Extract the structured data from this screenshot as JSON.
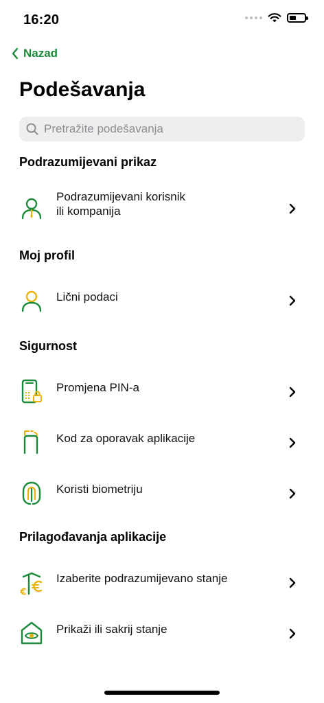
{
  "status": {
    "time": "16:20",
    "battery_level": 0.45
  },
  "nav": {
    "back_label": "Nazad"
  },
  "page": {
    "title": "Podešavanja"
  },
  "search": {
    "placeholder": "Pretražite podešavanja"
  },
  "sections": [
    {
      "title": "Podrazumijevani prikaz",
      "items": [
        {
          "label_line1": "Podrazumijevani korisnik",
          "label_line2": "ili kompanija",
          "icon": "user-default-icon"
        }
      ]
    },
    {
      "title": "Moj profil",
      "items": [
        {
          "label": "Lični podaci",
          "icon": "user-icon"
        }
      ]
    },
    {
      "title": "Sigurnost",
      "items": [
        {
          "label": "Promjena PIN-a",
          "icon": "phone-lock-icon"
        },
        {
          "label": "Kod za oporavak aplikacije",
          "icon": "app-recovery-icon"
        },
        {
          "label": "Koristi biometriju",
          "icon": "fingerprint-icon"
        }
      ]
    },
    {
      "title": "Prilagođavanja aplikacije",
      "items": [
        {
          "label": "Izaberite podrazumijevano stanje",
          "icon": "euro-balance-icon"
        },
        {
          "label": "Prikaži ili sakrij stanje",
          "icon": "home-eye-icon"
        }
      ]
    }
  ],
  "colors": {
    "accent_green": "#1a8a3a",
    "accent_yellow": "#e8b20c"
  }
}
